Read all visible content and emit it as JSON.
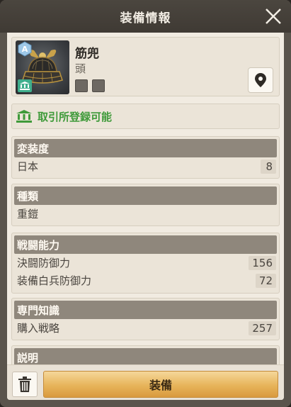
{
  "header": {
    "title": "装備情報"
  },
  "item": {
    "name": "筋兜",
    "slot": "頭",
    "tier_icon": "a-tier-badge-icon",
    "bank_icon": "bank-icon"
  },
  "trade": {
    "label": "取引所登録可能",
    "color": "#3f9a3a"
  },
  "sections": {
    "transform": {
      "title": "変装度",
      "rows": [
        {
          "label": "日本",
          "value": "8"
        }
      ]
    },
    "type": {
      "title": "種類",
      "rows": [
        {
          "label": "重鎧"
        }
      ]
    },
    "combat": {
      "title": "戦闘能力",
      "rows": [
        {
          "label": "決闘防御力",
          "value": "156"
        },
        {
          "label": "装備白兵防御力",
          "value": "72"
        }
      ]
    },
    "knowledge": {
      "title": "専門知識",
      "rows": [
        {
          "label": "購入戦略",
          "value": "257"
        }
      ]
    },
    "description": {
      "title": "説明"
    }
  },
  "actions": {
    "equip_label": "装備"
  },
  "colors": {
    "accent_button": "#e7b45a",
    "section_header": "#8f877c",
    "header_bg": "#3f3a34"
  }
}
